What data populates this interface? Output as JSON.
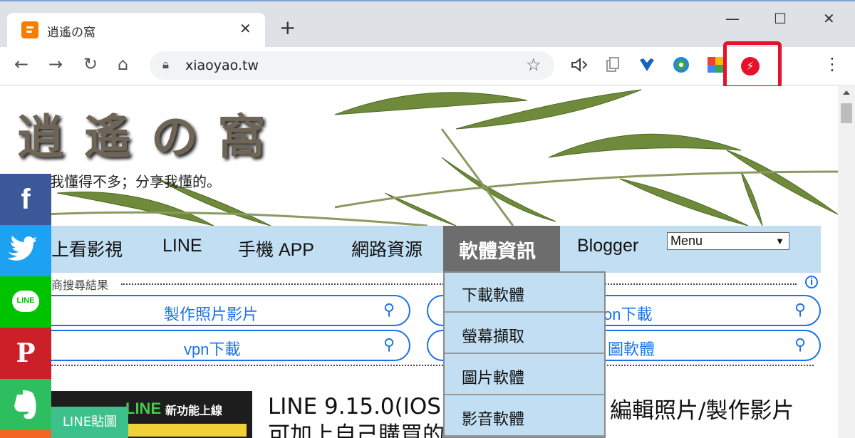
{
  "browser": {
    "tab_title": "逍遙の窩",
    "tab_close": "✕",
    "newtab": "+",
    "url": "xiaoyao.tw",
    "window_controls": {
      "minimize": "—",
      "maximize": "☐",
      "close": "✕"
    }
  },
  "site": {
    "title": "逍遙の窩",
    "tagline": "我懂得不多；分享我懂的。",
    "nav": [
      "上看影視",
      "LINE",
      "手機 APP",
      "網路資源",
      "軟體資訊",
      "Blogger"
    ],
    "menu_select": "Menu",
    "dropdown": [
      "下載軟體",
      "螢幕擷取",
      "圖片軟體",
      "影音軟體"
    ]
  },
  "ads": {
    "label": "商搜尋結果",
    "info": "i",
    "search": [
      "製作照片影片",
      "on下載",
      "vpn下載",
      "圖軟體"
    ]
  },
  "post": {
    "thumb_line": "LINE",
    "thumb_new": "新功能上線",
    "badge": "LINE貼圖",
    "title_line1": "LINE 9.15.0(IOS",
    "title_line2": "可加上自己購買的",
    "title_right": "編輯照片/製作影片"
  },
  "social": {
    "facebook": "f",
    "line": "LINE",
    "pinterest": "P"
  },
  "colors": {
    "nav_bg": "#c2def3",
    "nav_active": "#6d6d6d",
    "link_blue": "#1a73e8",
    "highlight_red": "#e8102a",
    "facebook": "#3b5998",
    "twitter": "#1da1f2",
    "line": "#00c300",
    "pinterest": "#cb2027",
    "evernote": "#2dbe60"
  }
}
